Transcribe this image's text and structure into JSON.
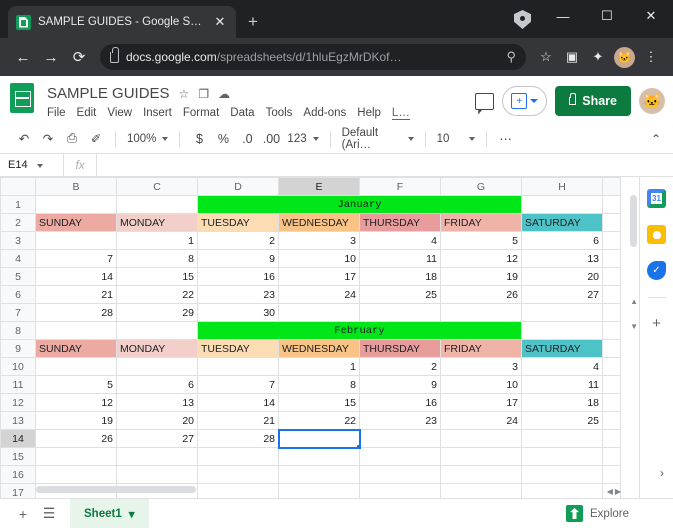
{
  "browser": {
    "tab": {
      "title": "SAMPLE GUIDES - Google Sheets",
      "favicon": "sheets-icon",
      "close": "✕"
    },
    "new_tab": "+",
    "window": {
      "minimize": "—",
      "maximize": "☐",
      "close": "✕"
    },
    "nav": {
      "back": "←",
      "forward": "→",
      "reload": "⟳"
    },
    "url": {
      "host": "docs.google.com",
      "path": "/spreadsheets/d/1hluEgzMrDKof…"
    },
    "omni": {
      "zoom": "⚲",
      "bookmark": "☆"
    },
    "icons": {
      "reading_list": "▣",
      "extensions": "✦",
      "profile": "🐱",
      "menu": "⋮"
    }
  },
  "sheets": {
    "doc_title": "SAMPLE GUIDES",
    "title_icons": {
      "star": "☆",
      "move": "❐",
      "cloud": "☁"
    },
    "menus": [
      "File",
      "Edit",
      "View",
      "Insert",
      "Format",
      "Data",
      "Tools",
      "Add-ons",
      "Help"
    ],
    "menu_overflow": "L…",
    "header_right": {
      "comment": "comment-icon",
      "meet": "+",
      "share_label": "Share"
    },
    "toolbar": {
      "undo": "↶",
      "redo": "↷",
      "print": "⎙",
      "paint": "✐",
      "zoom": "100%",
      "currency": "$",
      "percent": "%",
      "dec_decrease": ".0",
      "dec_increase": ".00",
      "formats": "123",
      "font": "Default (Ari…",
      "font_size": "10",
      "more": "⋯",
      "collapse": "⌃"
    },
    "formula_bar": {
      "name_box": "E14",
      "fx": "fx",
      "value": ""
    }
  },
  "grid": {
    "columns": [
      "B",
      "C",
      "D",
      "E",
      "F",
      "G",
      "H"
    ],
    "selected_column": "E",
    "rows": [
      "1",
      "2",
      "3",
      "4",
      "5",
      "6",
      "7",
      "8",
      "9",
      "10",
      "11",
      "12",
      "13",
      "14",
      "15",
      "16",
      "17"
    ],
    "selected_row": "14",
    "selected_cell": "E14",
    "day_headers": [
      "SUNDAY",
      "MONDAY",
      "TUESDAY",
      "WEDNESDAY",
      "THURSDAY",
      "FRIDAY",
      "SATURDAY"
    ],
    "colors": {
      "month_banner": "#00e618",
      "sunday": "#ecaaa2",
      "monday": "#f3cfc9",
      "tuesday": "#fcdcb3",
      "wednesday": "#f8c384",
      "thursday": "#e89c9c",
      "friday": "#f0b3a8",
      "saturday": "#4ec3c7",
      "selection": "#1a73e8"
    },
    "months": [
      {
        "name": "January",
        "banner_row": "1",
        "header_row": "2",
        "weeks": [
          [
            "",
            "",
            "1",
            "2",
            "3",
            "4",
            "5"
          ],
          [
            "6",
            "7",
            "8",
            "9",
            "10",
            "11",
            "12"
          ],
          [
            "13",
            "14",
            "15",
            "16",
            "17",
            "18",
            "19"
          ],
          [
            "20",
            "21",
            "22",
            "23",
            "24",
            "25",
            "26"
          ],
          [
            "27",
            "28",
            "29",
            "30",
            "",
            "",
            ""
          ]
        ]
      },
      {
        "name": "February",
        "banner_row": "8",
        "header_row": "9",
        "weeks": [
          [
            "",
            "",
            "",
            "1",
            "2",
            "3",
            "4"
          ],
          [
            "5",
            "6",
            "7",
            "8",
            "9",
            "10",
            "11"
          ],
          [
            "12",
            "13",
            "14",
            "15",
            "16",
            "17",
            "18"
          ],
          [
            "19",
            "20",
            "21",
            "22",
            "23",
            "24",
            "25"
          ],
          [
            "26",
            "27",
            "28",
            "",
            "",
            "",
            ""
          ]
        ]
      }
    ],
    "january_rows": [
      {
        "row": "3",
        "cells": [
          "",
          "1",
          "2",
          "3",
          "4",
          "5",
          "6"
        ]
      },
      {
        "row": "4",
        "cells": [
          "7",
          "8",
          "9",
          "10",
          "11",
          "12",
          "13"
        ]
      },
      {
        "row": "5",
        "cells": [
          "14",
          "15",
          "16",
          "17",
          "18",
          "19",
          "20"
        ]
      },
      {
        "row": "6",
        "cells": [
          "21",
          "22",
          "23",
          "24",
          "25",
          "26",
          "27"
        ]
      },
      {
        "row": "7",
        "cells": [
          "28",
          "29",
          "30",
          "",
          "",
          "",
          ""
        ]
      }
    ],
    "february_rows": [
      {
        "row": "10",
        "cells": [
          "",
          "",
          "",
          "1",
          "2",
          "3",
          "4"
        ]
      },
      {
        "row": "11",
        "cells": [
          "5",
          "6",
          "7",
          "8",
          "9",
          "10",
          "11"
        ]
      },
      {
        "row": "12",
        "cells": [
          "12",
          "13",
          "14",
          "15",
          "16",
          "17",
          "18"
        ]
      },
      {
        "row": "13",
        "cells": [
          "19",
          "20",
          "21",
          "22",
          "23",
          "24",
          "25"
        ]
      },
      {
        "row": "14",
        "cells": [
          "26",
          "27",
          "28",
          "",
          "",
          "",
          ""
        ]
      }
    ],
    "empty_rows": [
      "15",
      "16",
      "17"
    ]
  },
  "rail": {
    "calendar": "31",
    "keep": "keep-icon",
    "tasks": "✓",
    "add": "+",
    "expand": "›"
  },
  "bottom": {
    "add_sheet": "+",
    "all_sheets": "☰",
    "sheet_name": "Sheet1",
    "sheet_caret": "▾",
    "explore": "Explore"
  }
}
